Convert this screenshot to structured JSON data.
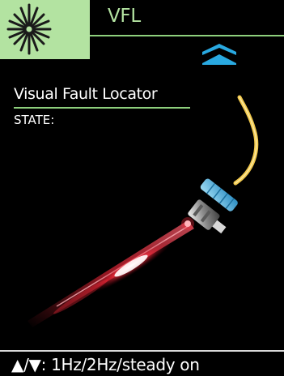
{
  "header": {
    "mode_icon": "laser-burst-icon",
    "title": "VFL",
    "nav_icon": "double-chevron-up-icon"
  },
  "main": {
    "title": "Visual Fault Locator",
    "state_label": "STATE:",
    "illustration": "fiber-connector-emitting-red-laser"
  },
  "footer": {
    "hint": "▲/▼: 1Hz/2Hz/steady on"
  },
  "colors": {
    "accent_green": "#b3e3a1",
    "line_green": "#8ed07d",
    "arrow_blue": "#29a9e1",
    "background": "#000000",
    "laser_red": "#ff2a3c",
    "fiber_yellow": "#f2c94c",
    "boot_blue": "#4fb3df"
  }
}
